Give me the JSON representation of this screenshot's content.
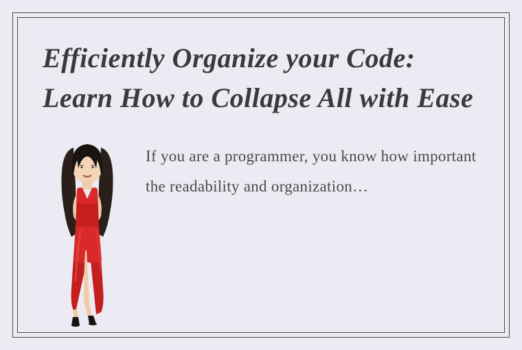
{
  "title": "Efficiently Organize your Code: Learn How to Collapse All with Ease",
  "body": "If you are a programmer, you know how important the readability and organization…"
}
